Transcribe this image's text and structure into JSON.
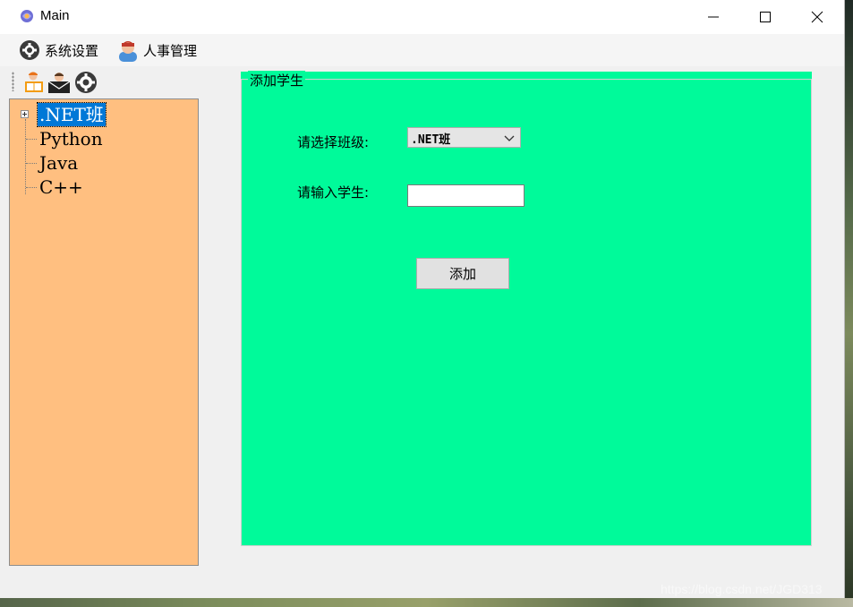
{
  "window": {
    "title": "Main",
    "controls": {
      "minimize_icon": "minimize-icon",
      "maximize_icon": "maximize-icon",
      "close_icon": "close-icon"
    }
  },
  "menu": {
    "items": [
      {
        "label": "系统设置",
        "icon": "gear-icon"
      },
      {
        "label": "人事管理",
        "icon": "person-icon"
      }
    ]
  },
  "toolbar": {
    "buttons": [
      {
        "icon": "user-book-icon"
      },
      {
        "icon": "user-mail-icon"
      },
      {
        "icon": "gear-icon"
      }
    ]
  },
  "tree": {
    "nodes": [
      {
        "label": ".NET班",
        "selected": true,
        "expandable": true
      },
      {
        "label": "Python"
      },
      {
        "label": "Java"
      },
      {
        "label": "C++"
      }
    ]
  },
  "group": {
    "title": "添加学生",
    "class_label": "请选择班级:",
    "class_selected": ".NET班",
    "student_label": "请输入学生:",
    "student_value": "",
    "add_button": "添加"
  },
  "colors": {
    "tree_bg": "#ffbf80",
    "group_bg": "#00fa9a",
    "selection": "#0078d7"
  },
  "watermark": "https://blog.csdn.net/JGD313"
}
